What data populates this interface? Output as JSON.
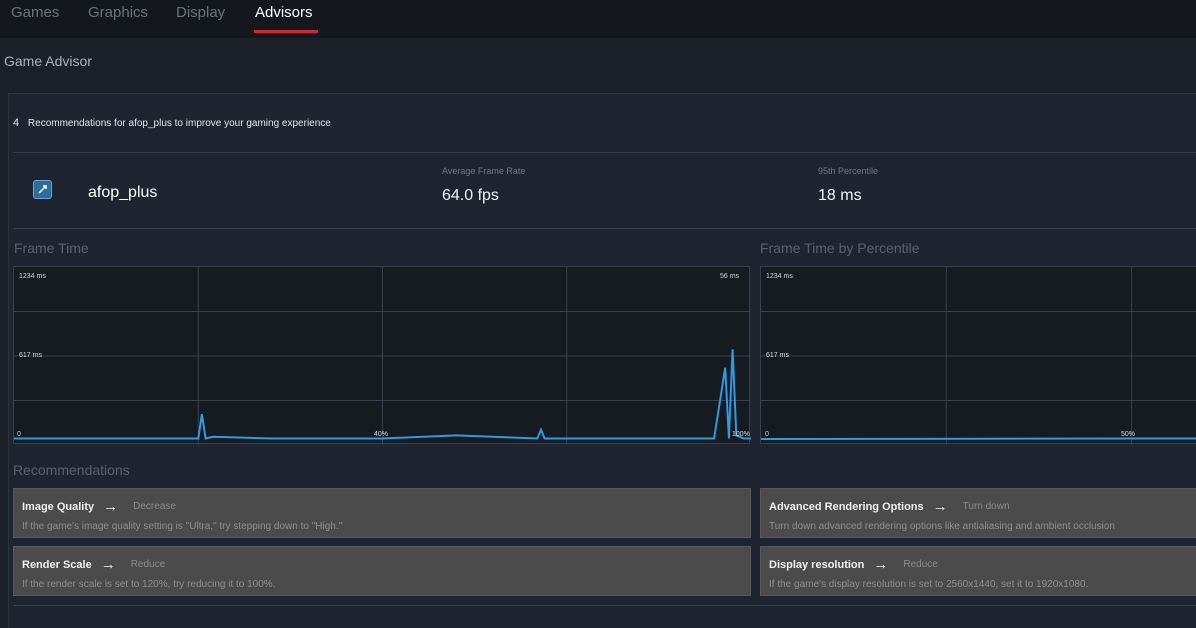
{
  "tabs": [
    {
      "label": "Games",
      "active": false
    },
    {
      "label": "Graphics",
      "active": false
    },
    {
      "label": "Display",
      "active": false
    },
    {
      "label": "Advisors",
      "active": true
    }
  ],
  "section_title": "Game Advisor",
  "recommendations_heading": {
    "count": "4",
    "text": "Recommendations for afop_plus to improve your gaming experience"
  },
  "game": {
    "name": "afop_plus",
    "icon": "game-app-icon"
  },
  "stats": {
    "avg_frame_rate_label": "Average Frame Rate",
    "avg_frame_rate_value": "64.0 fps",
    "percentile_label": "95th Percentile",
    "percentile_value": "18 ms"
  },
  "charts": {
    "frame_time_title": "Frame Time",
    "frame_time_top": "1234 ms",
    "frame_time_mid": "617 ms",
    "frame_time_bottom": "0",
    "frame_time_top_right": "56 ms",
    "frame_time_x_mid": "40%",
    "frame_time_x_right": "100%",
    "percentile_title": "Frame Time by Percentile",
    "percentile_top": "1234 ms",
    "percentile_mid": "617 ms",
    "percentile_bottom": "0",
    "percentile_x_mid": "50%"
  },
  "chart_data": [
    {
      "type": "line",
      "title": "Frame Time",
      "xlim": [
        0,
        100
      ],
      "ylim": [
        0,
        1234
      ],
      "x": [
        0,
        20,
        25,
        25.5,
        26,
        27,
        35,
        50,
        60,
        71,
        71.5,
        72,
        80,
        95,
        96.5,
        97,
        97.5,
        98,
        98.5,
        99,
        100
      ],
      "y": [
        18,
        18,
        18,
        190,
        18,
        30,
        18,
        18,
        40,
        18,
        80,
        18,
        18,
        18,
        520,
        18,
        650,
        40,
        30,
        18,
        18
      ],
      "color": "#2f9be0"
    },
    {
      "type": "line",
      "title": "Frame Time by Percentile",
      "xlim": [
        0,
        100
      ],
      "ylim": [
        0,
        1234
      ],
      "x": [
        0,
        50,
        100
      ],
      "y": [
        14,
        16,
        18
      ],
      "color": "#2f9be0"
    }
  ],
  "recommendations_title": "Recommendations",
  "recommendations": [
    {
      "name": "Image Quality",
      "action": "Decrease",
      "description": "If the game's image quality setting is \"Ultra,\" try stepping down to \"High.\""
    },
    {
      "name": "Advanced Rendering Options",
      "action": "Turn down",
      "description": "Turn down advanced rendering options like antialiasing and ambient occlusion"
    },
    {
      "name": "Render Scale",
      "action": "Reduce",
      "description": "If the render scale is set to 120%, try reducing it to 100%."
    },
    {
      "name": "Display resolution",
      "action": "Reduce",
      "description": "If the game's display resolution is set to 2560x1440, set it to 1920x1080."
    }
  ],
  "colors": {
    "accent_underline": "#d1263d",
    "chart_line": "#2f9be0",
    "card_bg": "#4b4b4b"
  }
}
